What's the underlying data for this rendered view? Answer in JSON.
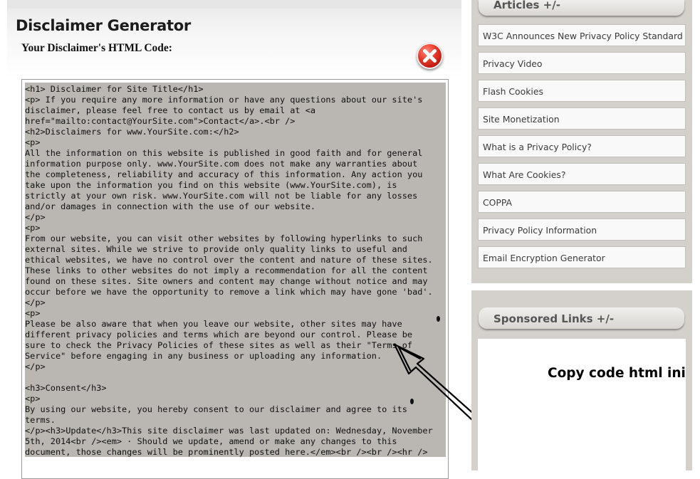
{
  "panel": {
    "title": "Disclaimer Generator",
    "subtitle": "Your Disclaimer's HTML Code:",
    "close_icon": "close-x-icon",
    "code_lines": [
      "<h1> Disclaimer for Site Title</h1>",
      "<p> If you require any more information or have any questions about our site's",
      "disclaimer, please feel free to contact us by email at <a",
      "href=\"mailto:contact@YourSite.com\">Contact</a>.<br />",
      "<h2>Disclaimers for www.YourSite.com:</h2>",
      "<p>",
      "All the information on this website is published in good faith and for general",
      "information purpose only. www.YourSite.com does not make any warranties about",
      "the completeness, reliability and accuracy of this information. Any action you",
      "take upon the information you find on this website (www.YourSite.com), is",
      "strictly at your own risk. www.YourSite.com will not be liable for any losses",
      "and/or damages in connection with the use of our website.",
      "</p>",
      "<p>",
      "From our website, you can visit other websites by following hyperlinks to such",
      "external sites. While we strive to provide only quality links to useful and",
      "ethical websites, we have no control over the content and nature of these sites.",
      "These links to other websites do not imply a recommendation for all the content",
      "found on these sites. Site owners and content may change without notice and may",
      "occur before we have the opportunity to remove a link which may have gone 'bad'.",
      "</p>",
      "<p>",
      "Please be also aware that when you leave our website, other sites may have",
      "different privacy policies and terms which are beyond our control. Please be",
      "sure to check the Privacy Policies of these sites as well as their \"Terms of",
      "Service\" before engaging in any business or uploading any information.",
      "</p>",
      "",
      "<h3>Consent</h3>",
      "<p>",
      "By using our website, you hereby consent to our disclaimer and agree to its",
      "terms.",
      "</p><h3>Update</h3>This site disclaimer was last updated on: Wednesday, November",
      "5th, 2014<br /><em> · Should we update, amend or make any changes to this",
      "document, those changes will be prominently posted here.</em><br /><br /><hr />"
    ]
  },
  "sidebar": {
    "articles_title": "Articles +/-",
    "articles": [
      "W3C Announces New Privacy Policy Standard",
      "Privacy Video",
      "Flash Cookies",
      "Site Monetization",
      "What is a Privacy Policy?",
      "What Are Cookies?",
      "COPPA",
      "Privacy Policy Information",
      "Email Encryption Generator"
    ],
    "sponsored_title": "Sponsored Links +/-"
  },
  "annotation": {
    "text": "Copy code html ini",
    "arrow_icon": "hand-drawn-arrow-icon"
  },
  "colors": {
    "selection": "#bab6b2",
    "sidebar_bg": "#d4d1cd",
    "close_red": "#e83b2c"
  }
}
